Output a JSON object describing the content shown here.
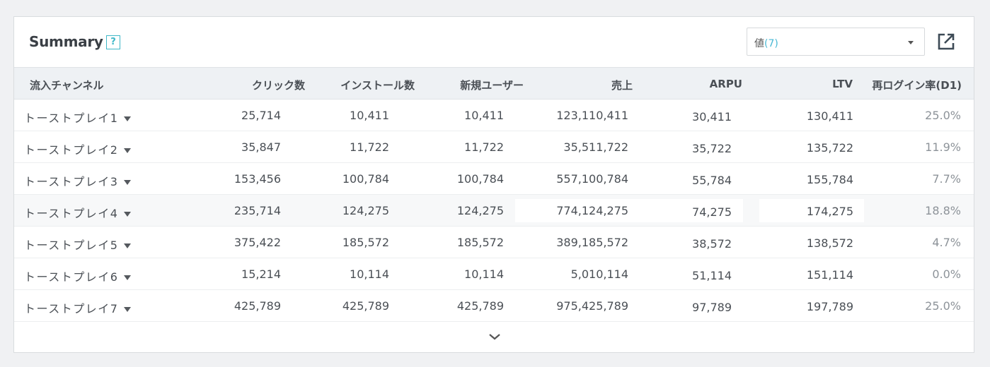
{
  "header": {
    "title": "Summary",
    "help_label": "?",
    "select_label": "値",
    "select_count": "(7)"
  },
  "columns": [
    "流入チャンネル",
    "クリック数",
    "インストール数",
    "新規ユーザー",
    "売上",
    "ARPU",
    "LTV",
    "再ログイン率(D1)"
  ],
  "rows": [
    {
      "name": "トーストプレイ1",
      "clicks": "25,714",
      "installs": "10,411",
      "new_users": "10,411",
      "sales": "123,110,411",
      "arpu": "30,411",
      "ltv": "130,411",
      "relogin": "25.0%"
    },
    {
      "name": "トーストプレイ2",
      "clicks": "35,847",
      "installs": "11,722",
      "new_users": "11,722",
      "sales": "35,511,722",
      "arpu": "35,722",
      "ltv": "135,722",
      "relogin": "11.9%"
    },
    {
      "name": "トーストプレイ3",
      "clicks": "153,456",
      "installs": "100,784",
      "new_users": "100,784",
      "sales": "557,100,784",
      "arpu": "55,784",
      "ltv": "155,784",
      "relogin": "7.7%"
    },
    {
      "name": "トーストプレイ4",
      "clicks": "235,714",
      "installs": "124,275",
      "new_users": "124,275",
      "sales": "774,124,275",
      "arpu": "74,275",
      "ltv": "174,275",
      "relogin": "18.8%"
    },
    {
      "name": "トーストプレイ5",
      "clicks": "375,422",
      "installs": "185,572",
      "new_users": "185,572",
      "sales": "389,185,572",
      "arpu": "38,572",
      "ltv": "138,572",
      "relogin": "4.7%"
    },
    {
      "name": "トーストプレイ6",
      "clicks": "15,214",
      "installs": "10,114",
      "new_users": "10,114",
      "sales": "5,010,114",
      "arpu": "51,114",
      "ltv": "151,114",
      "relogin": "0.0%"
    },
    {
      "name": "トーストプレイ7",
      "clicks": "425,789",
      "installs": "425,789",
      "new_users": "425,789",
      "sales": "975,425,789",
      "arpu": "97,789",
      "ltv": "197,789",
      "relogin": "25.0%"
    }
  ],
  "icons": {
    "help": "question-icon",
    "dropdown": "caret-down-icon",
    "export": "external-link-icon",
    "row_toggle": "triangle-down-icon",
    "more": "chevron-down-icon"
  },
  "colors": {
    "accent": "#3fb8c8",
    "count": "#49b8d4",
    "header_bg": "#eef1f4",
    "page_bg": "#f0f1f3"
  }
}
